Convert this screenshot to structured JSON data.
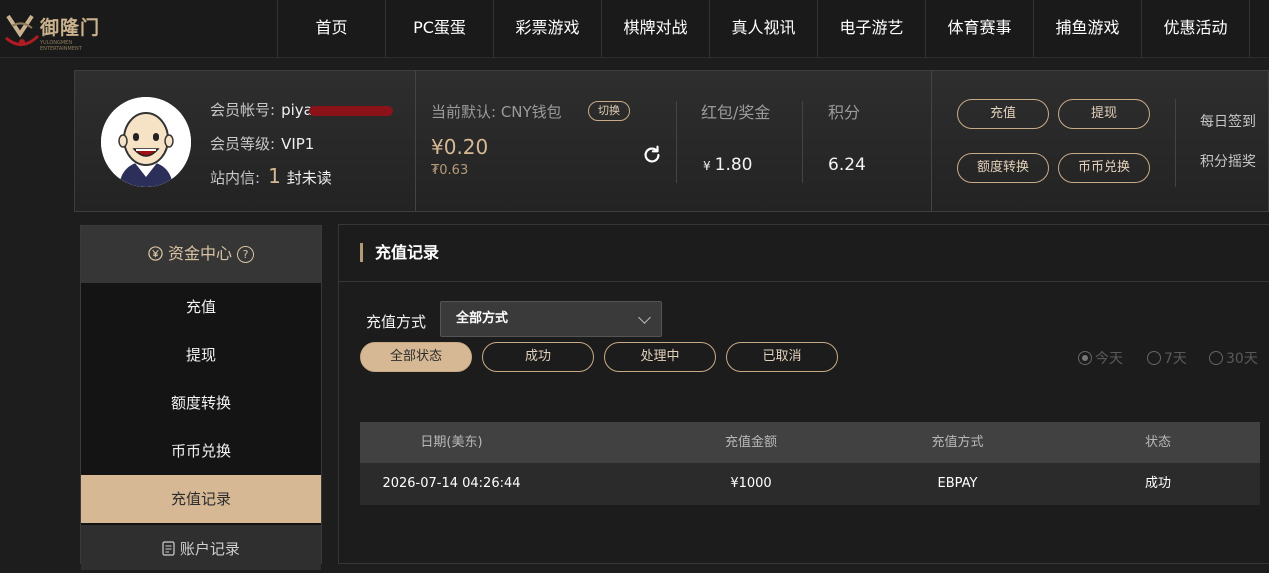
{
  "brand": {
    "name": "御隆门",
    "tagline": "YULONGMEN ENTERTAINMENT"
  },
  "nav": [
    "首页",
    "PC蛋蛋",
    "彩票游戏",
    "棋牌对战",
    "真人视讯",
    "电子游艺",
    "体育赛事",
    "捕鱼游戏",
    "优惠活动"
  ],
  "member": {
    "account_label": "会员帐号:",
    "account_value": "piya",
    "level_label": "会员等级:",
    "level_value": "VIP1",
    "message_label": "站内信:",
    "unread_count": "1",
    "unread_text": "封未读"
  },
  "wallet": {
    "label": "当前默认: CNY钱包",
    "switch_label": "切换",
    "balance": "¥0.20",
    "balance_sub": "₮0.63"
  },
  "stats": {
    "bonus_label": "红包/奖金",
    "bonus_currency": "¥",
    "bonus_value": "1.80",
    "points_label": "积分",
    "points_value": "6.24"
  },
  "actions": {
    "deposit": "充值",
    "withdraw": "提现",
    "transfer": "额度转换",
    "exchange": "币币兑换",
    "daily_checkin": "每日签到",
    "points_lottery": "积分摇奖"
  },
  "sidebar": {
    "header": "资金中心",
    "header_help": "?",
    "items": [
      "充值",
      "提现",
      "额度转换",
      "币币兑换",
      "充值记录"
    ],
    "active_index": 4,
    "footer": "账户记录"
  },
  "main": {
    "title": "充值记录",
    "method_label": "充值方式",
    "method_selected": "全部方式",
    "status_filters": [
      "全部状态",
      "成功",
      "处理中",
      "已取消"
    ],
    "active_status": 0,
    "range_options": [
      "今天",
      "7天",
      "30天"
    ],
    "range_selected": 0
  },
  "table": {
    "columns": [
      "日期(美东)",
      "充值金额",
      "充值方式",
      "状态"
    ],
    "rows": [
      [
        "2026-07-14 04:26:44",
        "¥1000",
        "EBPAY",
        "成功"
      ]
    ]
  },
  "colors": {
    "accent": "#d6b895",
    "border_accent": "#c9aa86",
    "background": "#1d1d1d",
    "redaction": "#8b1219"
  }
}
